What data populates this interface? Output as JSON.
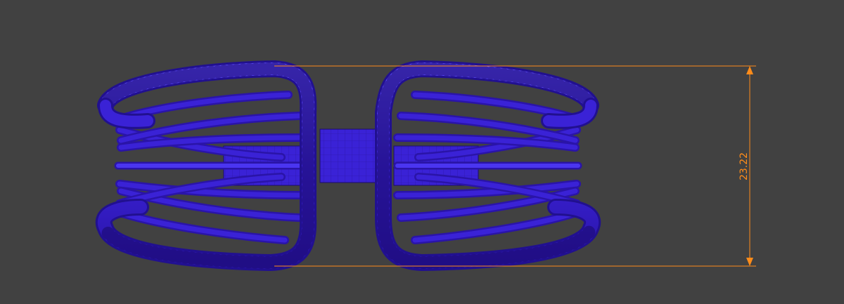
{
  "viewport": {
    "background_color": "#414141"
  },
  "model": {
    "name_icon": "wire-ring-mesh-icon",
    "fill_color": "#3a22d6",
    "shade_color": "#2a14a8",
    "highlight_color": "#5f4dff",
    "wire_color": "#1a0a6e"
  },
  "dimension": {
    "value_text": "23.22",
    "color": "#ff8c1a"
  }
}
